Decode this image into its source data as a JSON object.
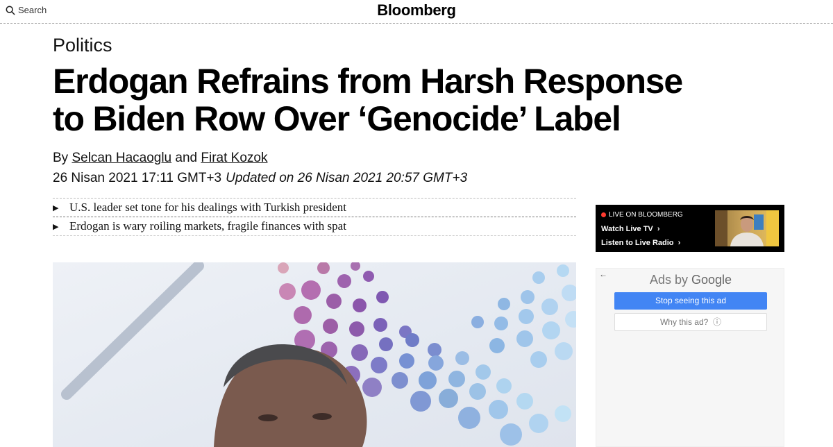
{
  "header": {
    "search_label": "Search",
    "logo": "Bloomberg"
  },
  "article": {
    "section": "Politics",
    "headline_line1": "Erdogan Refrains from Harsh Response",
    "headline_line2": "to Biden Row Over ‘Genocide’ Label",
    "by": "By",
    "author1": "Selcan Hacaoglu",
    "and": "and",
    "author2": "Firat Kozok",
    "published": "26 Nisan 2021 17:11 GMT+3",
    "updated": "Updated on 26 Nisan 2021 20:57 GMT+3",
    "abstract": [
      "U.S. leader set tone for his dealings with Turkish president",
      "Erdogan is wary roiling markets, fragile finances with spat"
    ]
  },
  "live": {
    "badge": "LIVE ON BLOOMBERG",
    "watch_tv": "Watch Live TV",
    "listen_radio": "Listen to Live Radio"
  },
  "ad": {
    "ads_by": "Ads by",
    "google": "Google",
    "stop_button": "Stop seeing this ad",
    "why_button": "Why this ad?",
    "back_icon": "back-arrow-icon",
    "info_icon": "info-icon"
  },
  "icons": {
    "search": "search-icon",
    "bullet": "triangle-right-icon",
    "chevron": "chevron-right-icon",
    "live_dot": "live-dot-icon"
  },
  "colors": {
    "ad_button": "#4285f4",
    "live_dot": "#ff3b30",
    "live_bg": "#000000"
  }
}
